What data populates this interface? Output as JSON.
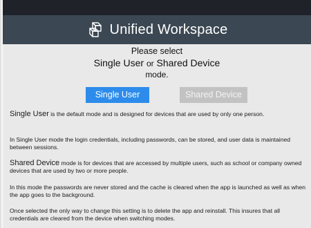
{
  "header": {
    "title": "Unified Workspace",
    "logo_icon": "cube-logo-icon",
    "background": "#3b4752"
  },
  "prompt": {
    "line1": "Please select",
    "option1": "Single User",
    "or": "or",
    "option2": "Shared Device",
    "line3": "mode."
  },
  "buttons": {
    "single_user": "Single User",
    "shared_device": "Shared Device",
    "selected_color": "#2d8ceb",
    "unselected_color": "#c2c2c2"
  },
  "descriptions": {
    "p1_lead": "Single User",
    "p1_rest": " is the default mode and is designed for devices that are used by only one person.",
    "p2": "In Single User mode the login credentials, including passwords, can be stored, and user data is maintained between sessions.",
    "p3_lead": "Shared Device",
    "p3_rest": " mode is for devices that are accessed by multiple users, such as school or company owned devices that are used by two or more people.",
    "p4": "In this mode the passwords are never stored and the cache is cleared when the app is launched as well as when the app goes to the background.",
    "p5": "Once selected the only way to change this setting is to delete the app and reinstall.  This insures that all credentials are cleared from the device when switching modes."
  }
}
